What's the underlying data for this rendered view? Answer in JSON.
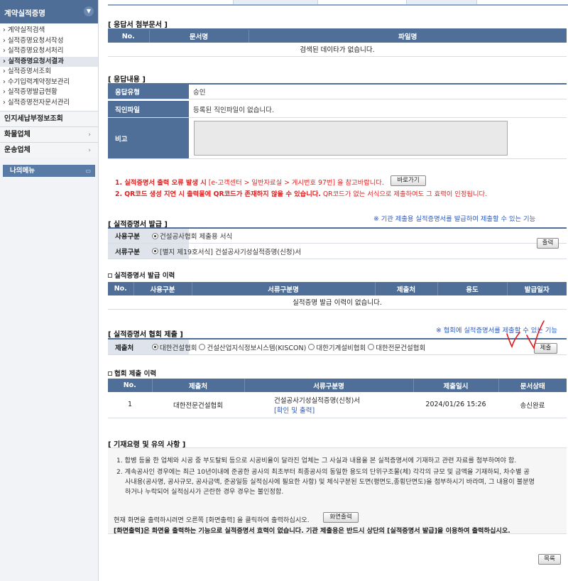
{
  "sidebar": {
    "header": "계약실적증명",
    "items": [
      {
        "label": "› 계약실적검색"
      },
      {
        "label": "› 실적증명요청서작성"
      },
      {
        "label": "› 실적증명요청서처리"
      },
      {
        "label": "› 실적증명요청서결과"
      },
      {
        "label": "› 실적증명서조회"
      },
      {
        "label": "› 수기입력계약정보관리"
      },
      {
        "label": "› 실적증명발급현황"
      },
      {
        "label": "› 실적증명전자문서관리"
      }
    ],
    "categories": [
      {
        "label": "인지세납부정보조회"
      },
      {
        "label": "화물업체"
      },
      {
        "label": "운송업체"
      }
    ],
    "my_menu": "나의메뉴"
  },
  "attachments": {
    "title": "[ 응답서 첨부문서 ]",
    "headers": [
      "No.",
      "문서명",
      "파일명"
    ],
    "empty": "검색된 데이타가 없습니다."
  },
  "response": {
    "title": "[ 응답내용 ]",
    "type_label": "응답유형",
    "type_value": "승인",
    "seal_label": "직인파일",
    "seal_value": "등록된 직인파일이 없습니다.",
    "remark_label": "비고"
  },
  "notices": {
    "line1_bold": "1. 실적증명서 출력 오류 발생 시",
    "line1_rest": " [e-고객센터 > 일반자료실 > 게시번호 97번] 을 참고바랍니다.",
    "shortcut_button": "바로가기",
    "line2_bold": "2. QR코드 생성 지연 시 출력물에 QR코드가 존재하지 않을 수 있습니다.",
    "line2_rest": " QR코드가 없는 서식으로 제출하여도 그 효력이 인정됩니다."
  },
  "issue": {
    "title": "[ 실적증명서 발급 ]",
    "note": "※ 기관 제출용 실적증명서를 발급하여 제출할 수 있는 기능",
    "use_label": "사용구분",
    "use_value": "건설공사협회 제출용 서식",
    "doc_label": "서류구분",
    "doc_value": "[별지 제19호서식] 건설공사기성실적증명(신청)서",
    "print_button": "출력"
  },
  "issue_history": {
    "title": "실적증명서 발급 이력",
    "headers": [
      "No.",
      "사용구분",
      "서류구분명",
      "제출처",
      "용도",
      "발급일자"
    ],
    "empty": "실적증명 발급 이력이 없습니다."
  },
  "submit": {
    "title": "[ 실적증명서 협회 제출 ]",
    "note": "※ 협회에 실적증명서를 제출할 수 있는 기능",
    "dest_label": "제출처",
    "options": [
      "대한건설협회",
      "건설산업지식정보시스템(KISCON)",
      "대한기계설비협회",
      "대한전문건설협회"
    ],
    "submit_button": "제출"
  },
  "submit_history": {
    "title": "협회 제출 이력",
    "headers": [
      "No.",
      "제출처",
      "서류구분명",
      "제출일시",
      "문서상태"
    ],
    "rows": [
      {
        "no": "1",
        "dest": "대한전문건설협회",
        "doc": "건설공사기성실적증명(신청)서",
        "link": "[확인 및 출력]",
        "date": "2024/01/26 15:26",
        "status": "송신완료"
      }
    ]
  },
  "guide": {
    "title": "[ 기재요령 및 유의 사항 ]",
    "item1": "1. 합병 등을 한 업체와 시공 중 부도탈퇴 등으로 시공비율이 달라진 업체는 그 사실과 내용을 본 실적증명서에 기재하고 관련 자료를 첨부하여야 함.",
    "item2a": "2. 계속공사인 경우에는 최근 10년이내에 준공한 공사의 최초부터 최종공사의 동일한 용도의 단위구조물(체) 각각의 규모 및 금액을 기재하되, 차수별 공",
    "item2b": "사내용(공사명, 공사규모, 공사금액, 준공일등 실적심사에 필요한 사항) 및 체식구분된 도면(평면도,종횡단면도)을 첨부하시기 바라며, 그 내용이 불분명",
    "item2c": "하거나 누락되어 실적심사가 곤란한 경우 경우는 불인정함.",
    "print_text": "현재 화면을 출력하시려면 오른쪽 [화면출력] 을 클릭하여 출력하십시오.",
    "print_button": "화면출력",
    "bold_text": "[화면출력]은 화면을 출력하는 기능으로 실적증명서 효력이 없습니다. 기관 제출용은 반드시 상단의 [실적증명서 발급]을 이용하여 출력하십시오."
  },
  "list_button": "목록",
  "colors": {
    "header_blue": "#4f6f98",
    "note_red": "#dd2222",
    "note_blue": "#2b59c3",
    "check_red": "#e01818"
  }
}
